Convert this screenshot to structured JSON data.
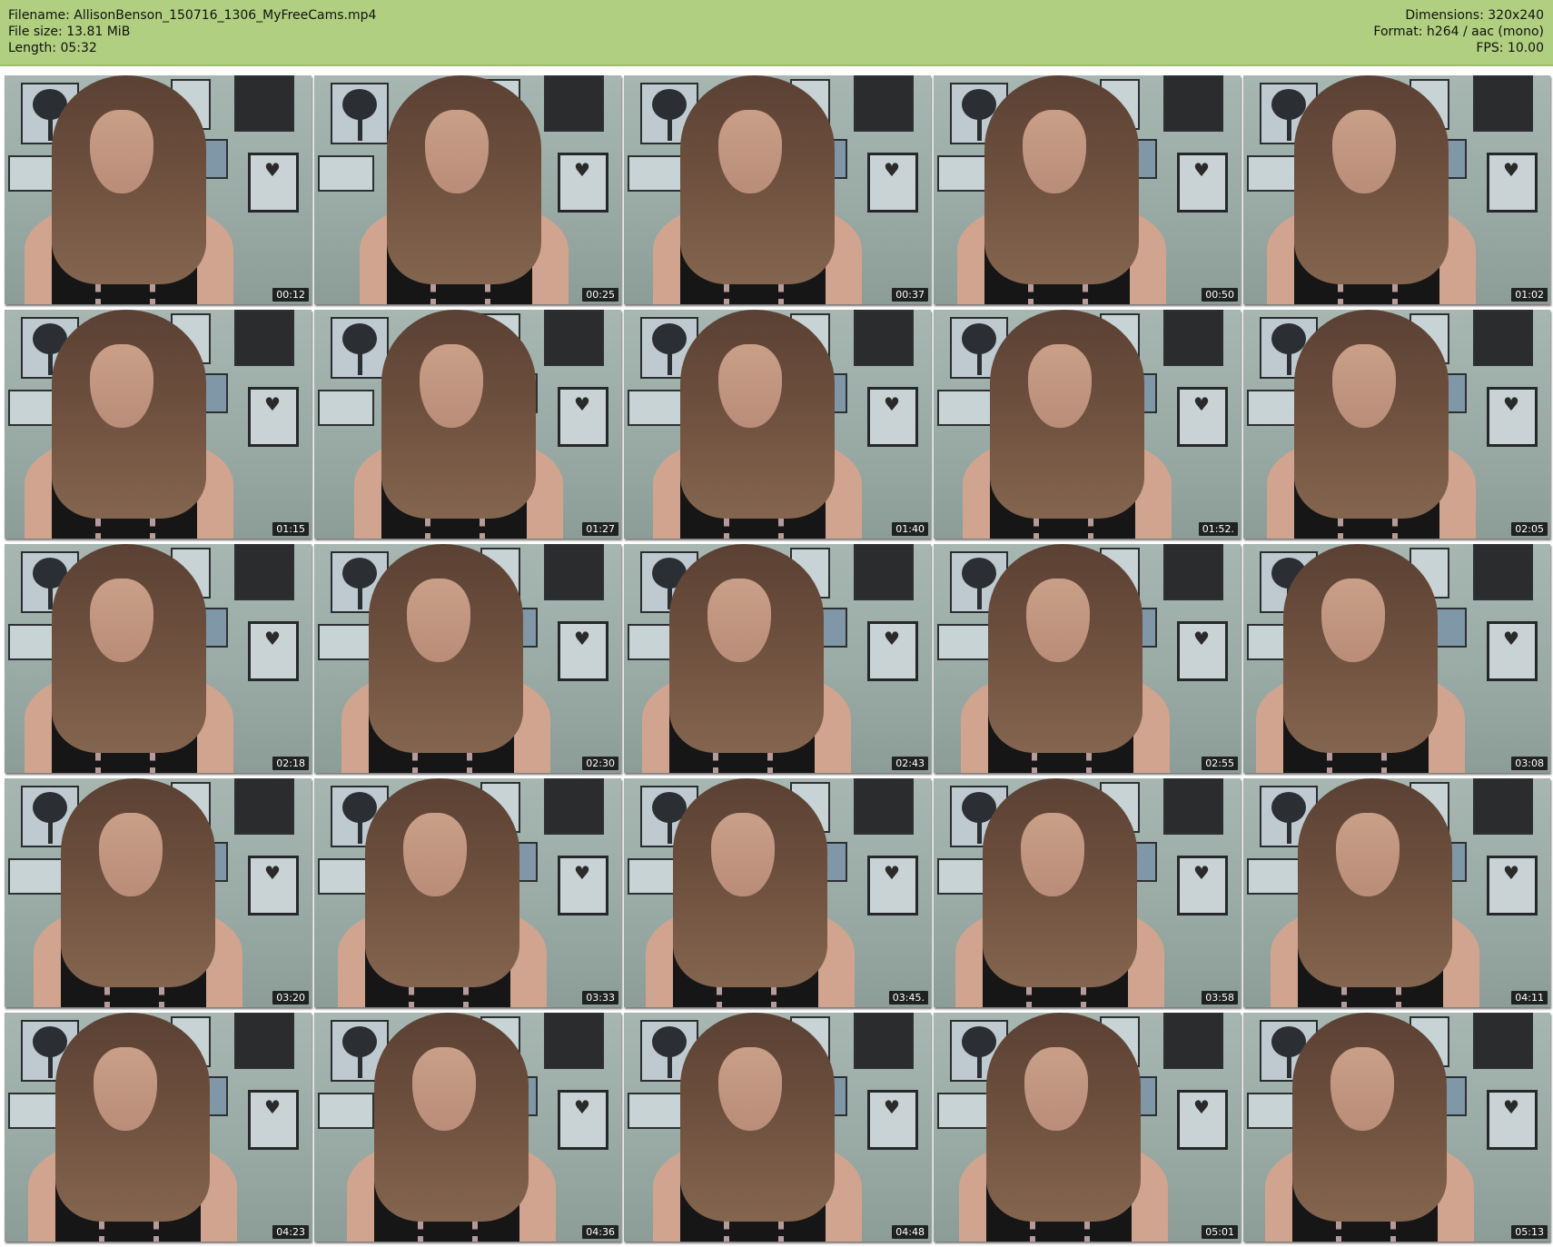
{
  "header": {
    "filename": "Filename: AllisonBenson_150716_1306_MyFreeCams.mp4",
    "filesize": "File size: 13.81 MiB",
    "length": "Length: 05:32",
    "dimensions": "Dimensions: 320x240",
    "format": "Format: h264 / aac (mono)",
    "fps": "FPS: 10.00"
  },
  "colors": {
    "header_bg": "#b0cf80",
    "page_bg": "#ffffff",
    "timestamp_bg": "#000000"
  },
  "thumbnails": [
    {
      "time": "00:12"
    },
    {
      "time": "00:25"
    },
    {
      "time": "00:37"
    },
    {
      "time": "00:50"
    },
    {
      "time": "01:02"
    },
    {
      "time": "01:15"
    },
    {
      "time": "01:27"
    },
    {
      "time": "01:40"
    },
    {
      "time": "01:52."
    },
    {
      "time": "02:05"
    },
    {
      "time": "02:18"
    },
    {
      "time": "02:30"
    },
    {
      "time": "02:43"
    },
    {
      "time": "02:55"
    },
    {
      "time": "03:08"
    },
    {
      "time": "03:20"
    },
    {
      "time": "03:33"
    },
    {
      "time": "03:45."
    },
    {
      "time": "03:58"
    },
    {
      "time": "04:11"
    },
    {
      "time": "04:23"
    },
    {
      "time": "04:36"
    },
    {
      "time": "04:48"
    },
    {
      "time": "05:01"
    },
    {
      "time": "05:13"
    }
  ]
}
